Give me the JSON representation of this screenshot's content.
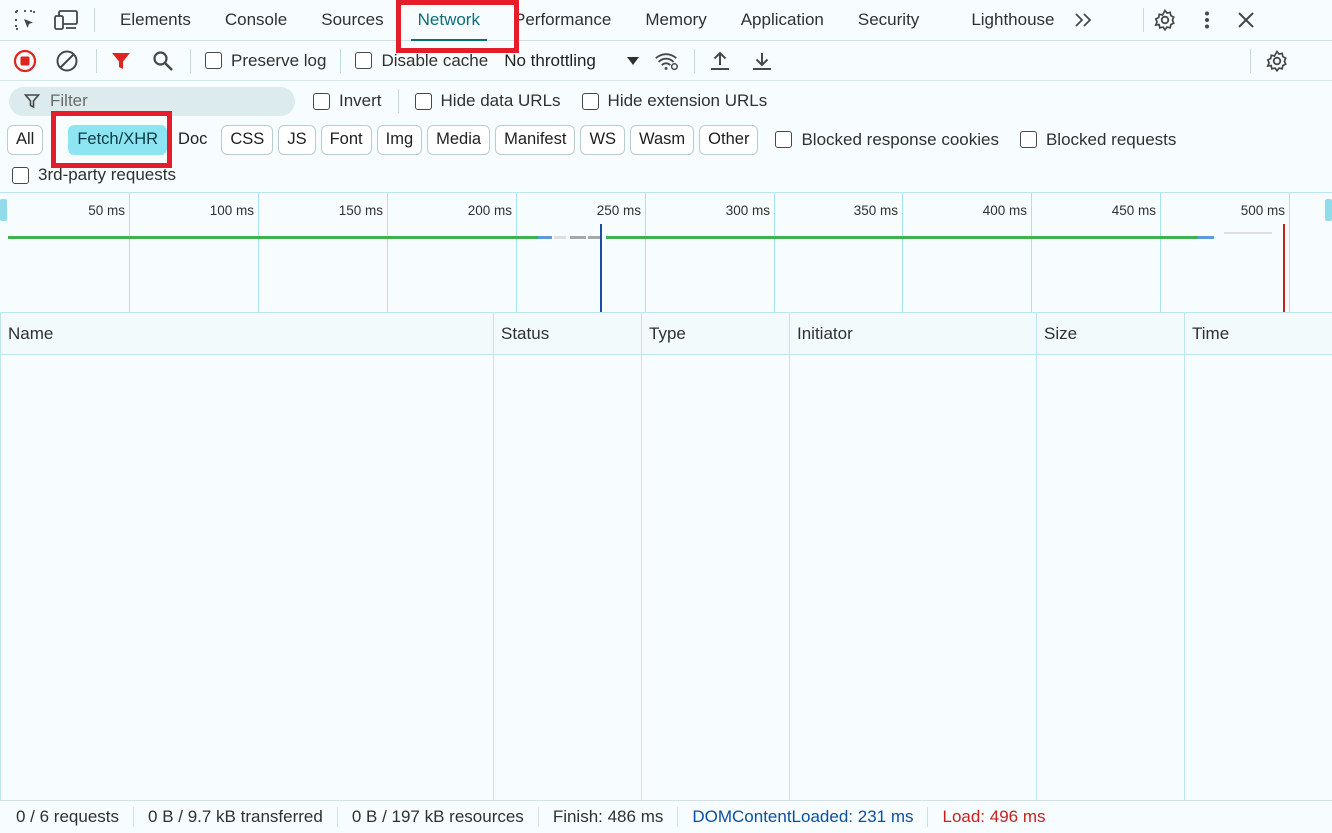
{
  "tabs": [
    {
      "label": "Elements"
    },
    {
      "label": "Console"
    },
    {
      "label": "Sources"
    },
    {
      "label": "Network"
    },
    {
      "label": "Performance"
    },
    {
      "label": "Memory"
    },
    {
      "label": "Application"
    },
    {
      "label": "Security"
    },
    {
      "label": "Lighthouse"
    }
  ],
  "active_tab": "Network",
  "toolbar": {
    "preserve_log": "Preserve log",
    "disable_cache": "Disable cache",
    "throttling": "No throttling"
  },
  "filter": {
    "placeholder": "Filter",
    "invert": "Invert",
    "hide_data_urls": "Hide data URLs",
    "hide_extension_urls": "Hide extension URLs"
  },
  "type_filters": [
    {
      "label": "All"
    },
    {
      "label": "Fetch/XHR"
    },
    {
      "label": "Doc"
    },
    {
      "label": "CSS"
    },
    {
      "label": "JS"
    },
    {
      "label": "Font"
    },
    {
      "label": "Img"
    },
    {
      "label": "Media"
    },
    {
      "label": "Manifest"
    },
    {
      "label": "WS"
    },
    {
      "label": "Wasm"
    },
    {
      "label": "Other"
    }
  ],
  "active_type_filter": "Fetch/XHR",
  "extra_filters": {
    "blocked_response_cookies": "Blocked response cookies",
    "blocked_requests": "Blocked requests",
    "third_party": "3rd-party requests"
  },
  "timeline": {
    "ticks": [
      "50 ms",
      "100 ms",
      "150 ms",
      "200 ms",
      "250 ms",
      "300 ms",
      "350 ms",
      "400 ms",
      "450 ms",
      "500 ms"
    ],
    "dom_content_loaded_ms": 231,
    "load_ms": 496
  },
  "columns": [
    {
      "label": "Name"
    },
    {
      "label": "Status"
    },
    {
      "label": "Type"
    },
    {
      "label": "Initiator"
    },
    {
      "label": "Size"
    },
    {
      "label": "Time"
    }
  ],
  "status": {
    "requests": "0 / 6 requests",
    "transferred": "0 B / 9.7 kB transferred",
    "resources": "0 B / 197 kB resources",
    "finish": "Finish: 486 ms",
    "dom_content_loaded": "DOMContentLoaded: 231 ms",
    "load": "Load: 496 ms"
  },
  "colors": {
    "accent": "#0b6e7a",
    "highlight": "#e41d2b",
    "chip_active": "#8ee5f2",
    "dcl_line": "#1a4fa3",
    "load_line": "#c5221f"
  },
  "icons": [
    "select-element-icon",
    "device-toolbar-icon",
    "more-tabs-icon",
    "settings-icon",
    "kebab-menu-icon",
    "close-icon",
    "record-stop-icon",
    "clear-icon",
    "filter-icon",
    "search-icon",
    "dropdown-arrow-icon",
    "network-conditions-icon",
    "import-har-icon",
    "export-har-icon",
    "network-settings-icon"
  ]
}
